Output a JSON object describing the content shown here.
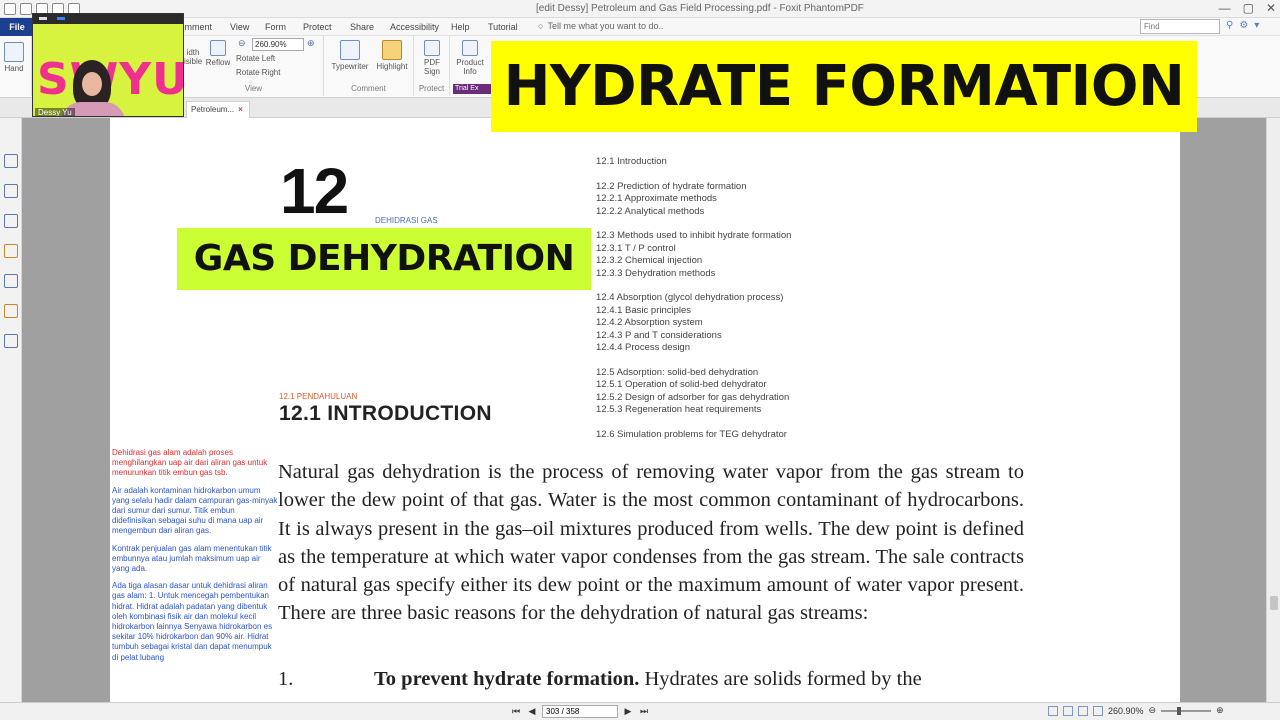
{
  "window": {
    "title": "[edit Dessy] Petroleum and Gas Field Processing.pdf - Foxit PhantomPDF",
    "controls": [
      "—",
      "▢",
      "✕"
    ]
  },
  "menu": {
    "file": "File",
    "tabs": [
      "Comment",
      "View",
      "Form",
      "Protect",
      "Share",
      "Accessibility",
      "Help",
      "Tutorial"
    ],
    "tell_me": "Tell me what you want to do..",
    "find_placeholder": "Find"
  },
  "ribbon": {
    "hand": "Hand",
    "zoom_value": "260.90%",
    "fit_width": "idth",
    "visible": "isible",
    "reflow": "Reflow",
    "rotate_left": "Rotate Left",
    "rotate_right": "Rotate Right",
    "view_group": "View",
    "typewriter": "Typewriter",
    "highlight": "Highlight",
    "comment_group": "Comment",
    "pdf_sign": "PDF Sign",
    "protect_group": "Protect",
    "product_info": "Product Info",
    "trial_label": "Trial Ex"
  },
  "webcam": {
    "logo_text": "SWYU",
    "name": "Dessy Yu"
  },
  "doc_tab": {
    "label": "Petroleum...",
    "close": "×"
  },
  "page": {
    "chapter_number": "12",
    "chapter_subtitle": "DEHIDRASI GAS",
    "toc": [
      "12.1 Introduction",
      "",
      "12.2 Prediction of hydrate formation",
      "12.2.1 Approximate methods",
      "12.2.2 Analytical methods",
      "",
      "12.3 Methods used to inhibit hydrate formation",
      "12.3.1 T / P control",
      "12.3.2 Chemical injection",
      "12.3.3 Dehydration methods",
      "",
      "12.4 Absorption (glycol dehydration process)",
      "12.4.1 Basic principles",
      "12.4.2 Absorption system",
      "12.4.3 P and T considerations",
      "12.4.4 Process design",
      "",
      "12.5 Adsorption: solid-bed dehydration",
      "12.5.1 Operation of solid-bed dehydrator",
      "12.5.2 Design of adsorber for gas dehydration",
      "12.5.3 Regeneration heat requirements",
      "",
      "12.6 Simulation problems for TEG dehydrator"
    ],
    "intro_subtitle": "12.1 PENDAHULUAN",
    "intro_title": "12.1    INTRODUCTION",
    "notes": [
      {
        "text": "Dehidrasi gas alam adalah proses menghilangkan uap air dari aliran gas untuk menurunkan titik embun gas tsb.",
        "color": "#e02b2b"
      },
      {
        "text": "Air adalah kontaminan hidrokarbon umum yang selalu hadir dalam campuran gas-minyak dari sumur dari sumur. Titik embun didefinisikan sebagai suhu di mana uap air mengembun dari aliran gas.",
        "color": "#2b56c8"
      },
      {
        "text": "Kontrak penjualan gas alam menentukan titik embunnya atau jumlah maksimum uap air yang ada.",
        "color": "#2b56c8"
      },
      {
        "text": "Ada tiga alasan dasar untuk dehidrasi aliran gas alam: 1. Untuk mencegah pembentukan hidrat. Hidrat adalah padatan yang dibentuk oleh kombinasi fisik air dan molekul kecil hidrokarbon lainnya Senyawa hidrokarbon es sekitar 10% hidrokarbon dan 90% air. Hidrat tumbuh sebagai kristal dan dapat menumpuk di pelat lubang",
        "color": "#2b56c8"
      }
    ],
    "body_paragraph": "Natural gas dehydration is the process of removing water vapor from the gas stream to lower the dew point of that gas. Water is the most common contaminant of hydrocarbons. It is always present in the gas–oil mixtures produced from wells. The dew point is defined as the temperature at which water vapor condenses from the gas stream. The sale contracts of natural gas specify either its dew point or the maximum amount of water vapor present. There are three basic reasons for the dehydration of natural gas streams:",
    "list_item_number": "1.",
    "list_item_bold": "To prevent hydrate formation.",
    "list_item_rest": " Hydrates are solids formed by the"
  },
  "overlays": {
    "hydrate": "HYDRATE FORMATION",
    "dehydration": "GAS DEHYDRATION",
    "hydrate_bg": "#ffff00",
    "dehydration_bg": "#ccff33"
  },
  "status": {
    "page_value": "303 / 358",
    "zoom": "260.90%"
  }
}
